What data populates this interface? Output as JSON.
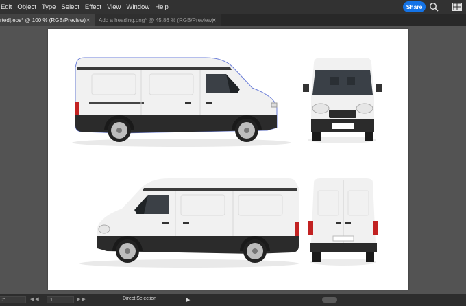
{
  "menu": [
    "Edit",
    "Object",
    "Type",
    "Select",
    "Effect",
    "View",
    "Window",
    "Help"
  ],
  "header": {
    "share_label": "Share",
    "search_icon": "search-icon",
    "panels_icon": "panels-icon"
  },
  "tabs": [
    {
      "label": "rted].eps* @ 100 % (RGB/Preview)",
      "active": true
    },
    {
      "label": "Add a heading.png* @ 45.86 % (RGB/Preview)",
      "active": false
    }
  ],
  "tab_close_glyph": "✕",
  "status": {
    "zoom": "0°",
    "page": "1",
    "tool": "Direct Selection",
    "nav_prev": "◀ ◀",
    "nav_next": "▶ ▶"
  },
  "colors": {
    "accent": "#1473e6",
    "canvas": "#535353",
    "artboard": "#ffffff"
  },
  "artwork": [
    "white-van-side-right",
    "white-van-front",
    "white-van-side-left",
    "white-van-rear"
  ]
}
